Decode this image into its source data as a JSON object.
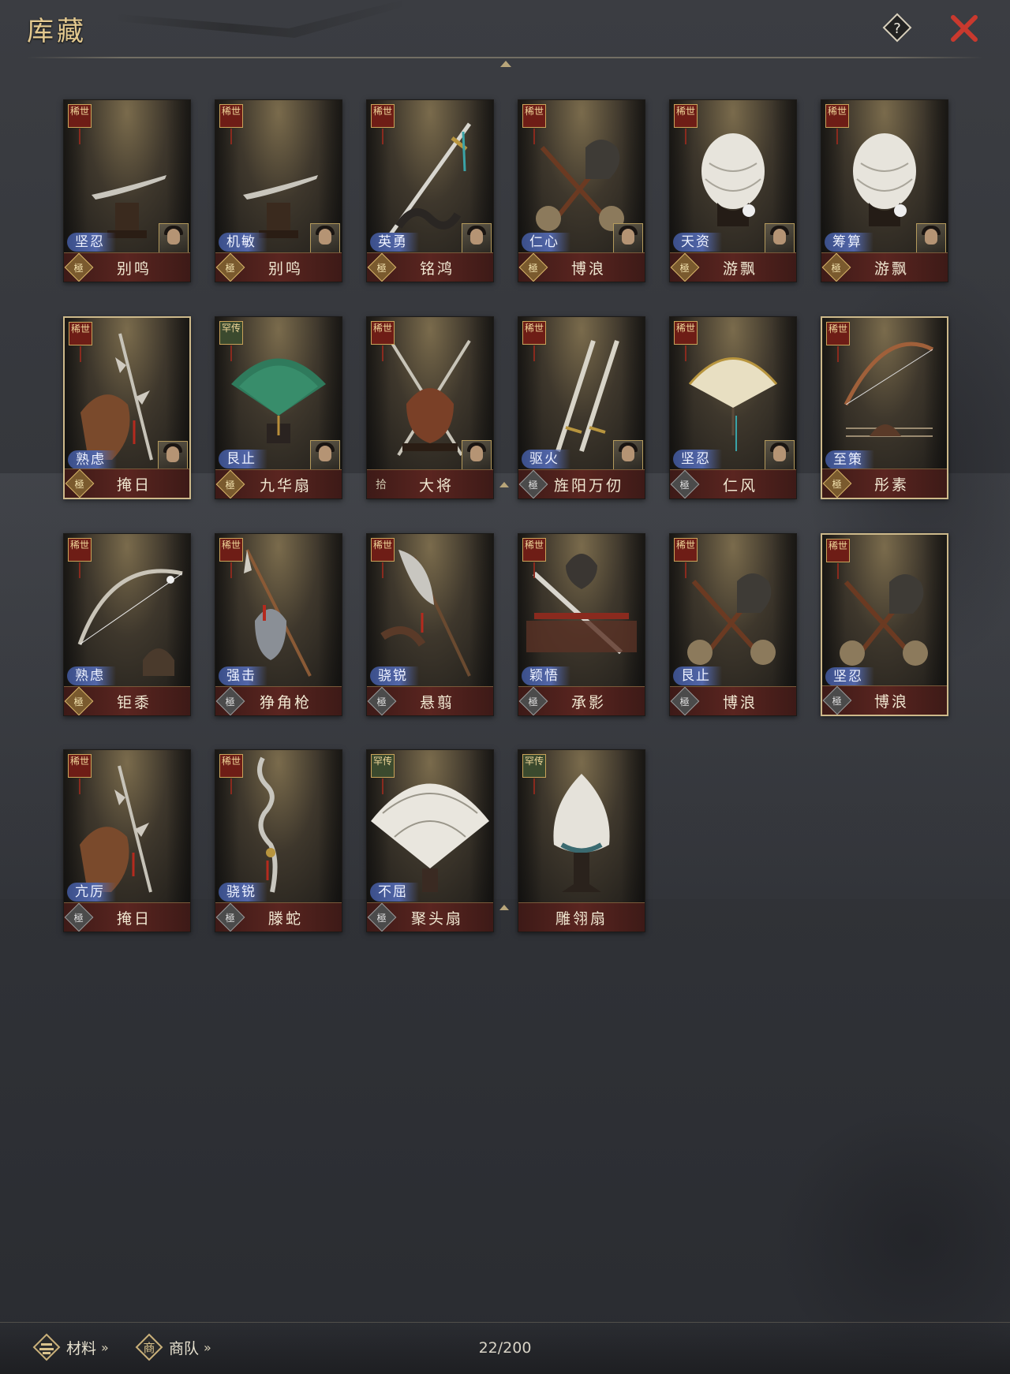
{
  "header": {
    "title": "库藏"
  },
  "grid": {
    "items": [
      {
        "rarity": "稀世",
        "skill": "坚忍",
        "name": "别鸣",
        "quality": "極",
        "quality_style": "gold",
        "has_portrait": true,
        "selected": false,
        "weapon": "saber"
      },
      {
        "rarity": "稀世",
        "skill": "机敏",
        "name": "别鸣",
        "quality": "極",
        "quality_style": "gold",
        "has_portrait": true,
        "selected": false,
        "weapon": "saber"
      },
      {
        "rarity": "稀世",
        "skill": "英勇",
        "name": "铭鸿",
        "quality": "極",
        "quality_style": "gold",
        "has_portrait": true,
        "selected": false,
        "weapon": "sword"
      },
      {
        "rarity": "稀世",
        "skill": "仁心",
        "name": "博浪",
        "quality": "極",
        "quality_style": "gold",
        "has_portrait": true,
        "selected": false,
        "weapon": "hammers"
      },
      {
        "rarity": "稀世",
        "skill": "天资",
        "name": "游飘",
        "quality": "極",
        "quality_style": "gold",
        "has_portrait": true,
        "selected": false,
        "weapon": "feather"
      },
      {
        "rarity": "稀世",
        "skill": "筹算",
        "name": "游飘",
        "quality": "極",
        "quality_style": "gold",
        "has_portrait": true,
        "selected": false,
        "weapon": "feather"
      },
      {
        "rarity": "稀世",
        "skill": "熟虑",
        "name": "掩日",
        "quality": "極",
        "quality_style": "gold",
        "has_portrait": true,
        "selected": true,
        "weapon": "halberd"
      },
      {
        "rarity": "罕传",
        "skill": "艮止",
        "name": "九华扇",
        "quality": "極",
        "quality_style": "gold",
        "has_portrait": true,
        "selected": false,
        "weapon": "fan-green"
      },
      {
        "rarity": "稀世",
        "skill": "",
        "name": "大将",
        "quality": "拾",
        "quality_style": "none",
        "has_portrait": true,
        "selected": false,
        "weapon": "spears"
      },
      {
        "rarity": "稀世",
        "skill": "驱火",
        "name": "旌阳万仞",
        "quality": "極",
        "quality_style": "low",
        "has_portrait": true,
        "selected": false,
        "weapon": "twin-swords"
      },
      {
        "rarity": "稀世",
        "skill": "坚忍",
        "name": "仁风",
        "quality": "極",
        "quality_style": "low",
        "has_portrait": true,
        "selected": false,
        "weapon": "fan-white"
      },
      {
        "rarity": "稀世",
        "skill": "至策",
        "name": "彤素",
        "quality": "極",
        "quality_style": "gold",
        "has_portrait": false,
        "selected": true,
        "weapon": "bow"
      },
      {
        "rarity": "稀世",
        "skill": "熟虑",
        "name": "钜黍",
        "quality": "極",
        "quality_style": "gold",
        "has_portrait": false,
        "selected": false,
        "weapon": "bow2"
      },
      {
        "rarity": "稀世",
        "skill": "强击",
        "name": "狰角枪",
        "quality": "極",
        "quality_style": "low",
        "has_portrait": false,
        "selected": false,
        "weapon": "spear"
      },
      {
        "rarity": "稀世",
        "skill": "骁锐",
        "name": "悬翦",
        "quality": "極",
        "quality_style": "low",
        "has_portrait": false,
        "selected": false,
        "weapon": "glaive"
      },
      {
        "rarity": "稀世",
        "skill": "颖悟",
        "name": "承影",
        "quality": "極",
        "quality_style": "low",
        "has_portrait": false,
        "selected": false,
        "weapon": "sword2"
      },
      {
        "rarity": "稀世",
        "skill": "艮止",
        "name": "博浪",
        "quality": "極",
        "quality_style": "low",
        "has_portrait": false,
        "selected": false,
        "weapon": "hammers"
      },
      {
        "rarity": "稀世",
        "skill": "坚忍",
        "name": "博浪",
        "quality": "極",
        "quality_style": "low",
        "has_portrait": false,
        "selected": true,
        "weapon": "hammers"
      },
      {
        "rarity": "稀世",
        "skill": "亢厉",
        "name": "掩日",
        "quality": "極",
        "quality_style": "low",
        "has_portrait": false,
        "selected": false,
        "weapon": "halberd"
      },
      {
        "rarity": "稀世",
        "skill": "骁锐",
        "name": "滕蛇",
        "quality": "極",
        "quality_style": "low",
        "has_portrait": false,
        "selected": false,
        "weapon": "snake-spear"
      },
      {
        "rarity": "罕传",
        "skill": "不屈",
        "name": "聚头扇",
        "quality": "極",
        "quality_style": "low",
        "has_portrait": false,
        "selected": false,
        "weapon": "fan-big"
      },
      {
        "rarity": "罕传",
        "skill": "",
        "name": "雕翎扇",
        "quality": "",
        "quality_style": "none",
        "has_portrait": false,
        "selected": false,
        "weapon": "feather2"
      }
    ]
  },
  "footer": {
    "materials_label": "材料",
    "caravan_label": "商队",
    "chevrons": "»",
    "capacity": "22/200"
  },
  "colors": {
    "accent_gold": "#e3c98f",
    "close_red": "#c0392b",
    "skill_blue": "#4a5e9e"
  }
}
